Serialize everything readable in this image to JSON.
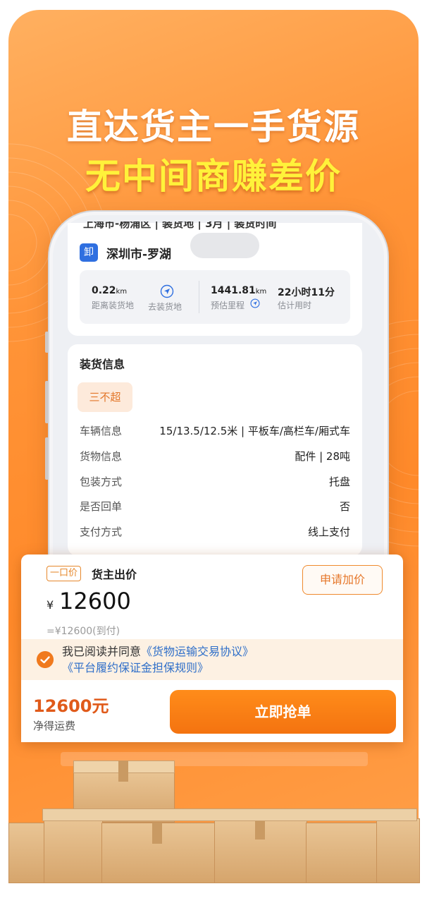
{
  "headline": {
    "line1": "直达货主一手货源",
    "line2": "无中间商赚差价"
  },
  "order": {
    "cut_row_text": "上海市-杨浦区 | 装货地 | 3月 | 装货时间",
    "unload_badge": "卸",
    "destination": "深圳市-罗湖",
    "stats": [
      {
        "value": "0.22",
        "unit": "km",
        "label": "距离装货地"
      },
      {
        "value": "",
        "unit": "",
        "label": "去装货地",
        "icon": "navigation-icon"
      },
      {
        "value": "1441.81",
        "unit": "km",
        "label": "预估里程",
        "icon": "navigation-icon"
      },
      {
        "value": "22小时11分",
        "unit": "",
        "label": "估计用时"
      }
    ]
  },
  "loading_info": {
    "title": "装货信息",
    "tag": "三不超",
    "rows": [
      {
        "label": "车辆信息",
        "value": "15/13.5/12.5米 | 平板车/高栏车/厢式车"
      },
      {
        "label": "货物信息",
        "value": "配件 | 28吨"
      },
      {
        "label": "包装方式",
        "value": "托盘"
      },
      {
        "label": "是否回单",
        "value": "否"
      },
      {
        "label": "支付方式",
        "value": "线上支付"
      }
    ]
  },
  "price_sheet": {
    "tag": "一口价",
    "label": "货主出价",
    "add_price_button": "申请加价",
    "currency": "¥",
    "amount": "12600",
    "sub_text": "=¥12600(到付)"
  },
  "agreement": {
    "prefix": "我已阅读并同意",
    "link1": "《货物运输交易协议》",
    "link2": "《平台履约保证金担保规则》"
  },
  "bottom": {
    "net_price": "12600元",
    "net_label": "净得运费",
    "grab_button": "立即抢单"
  },
  "colors": {
    "accent": "#f47310",
    "link": "#2f6fc9",
    "headline2": "#fff23a",
    "background": "#ff9438"
  }
}
